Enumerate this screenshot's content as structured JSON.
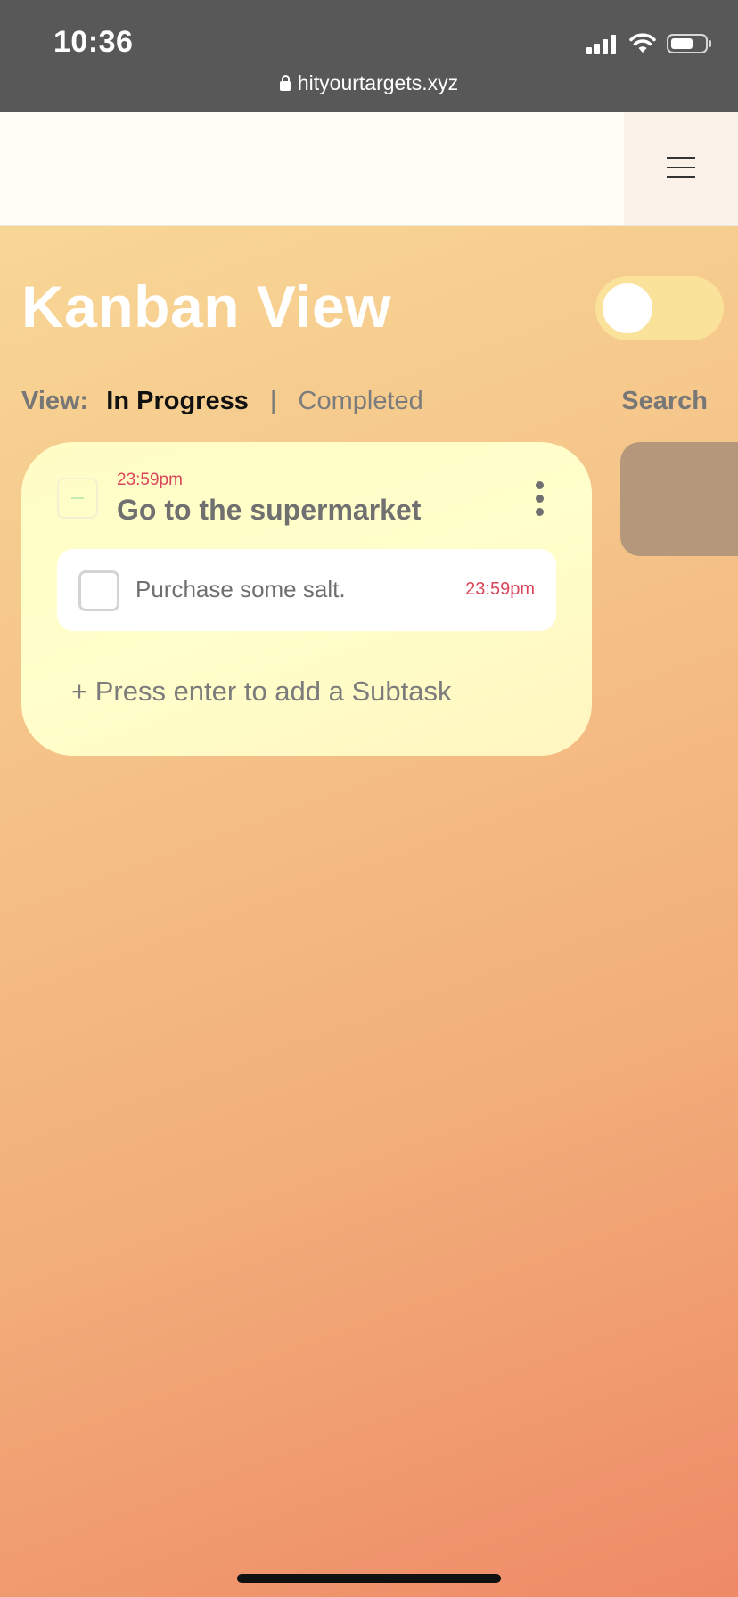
{
  "status_bar": {
    "time": "10:36",
    "icons": [
      "cellular-signal-icon",
      "wifi-icon",
      "battery-icon"
    ]
  },
  "browser": {
    "url": "hityourtargets.xyz",
    "lock_icon": "lock-icon"
  },
  "header": {
    "menu_icon": "hamburger-menu-icon"
  },
  "main": {
    "title": "Kanban View",
    "toggle": {
      "state": "off"
    },
    "view_label": "View:",
    "filters": {
      "in_progress": "In Progress",
      "separator": "|",
      "completed": "Completed",
      "active": "In Progress"
    },
    "search_label": "Search"
  },
  "task": {
    "time": "23:59pm",
    "title": "Go to the supermarket",
    "collapse_icon": "minus-icon",
    "more_icon": "more-vertical-icon",
    "subtasks": [
      {
        "text": "Purchase some salt.",
        "time": "23:59pm",
        "checked": false
      }
    ],
    "add_subtask_placeholder": "+ Press enter to add a Subtask"
  },
  "colors": {
    "browser_bar": "#585858",
    "header_bg": "#fffef4",
    "menu_bg": "#faf2e8",
    "gradient_start": "#f8d796",
    "gradient_end": "#ee8a66",
    "card_bg": "#ffffcb",
    "toggle_track": "#fbe29a",
    "time_red": "#d9465a",
    "next_column": "#b5977c"
  }
}
